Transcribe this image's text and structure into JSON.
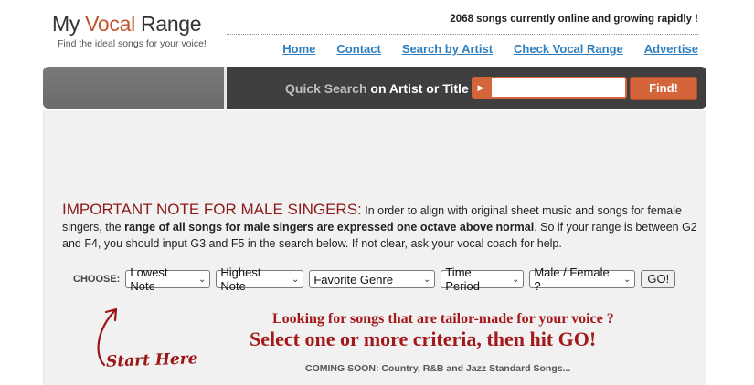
{
  "header": {
    "logo_part1": "My ",
    "logo_part2": "Vocal",
    "logo_part3": " Range",
    "tagline": "Find the ideal songs for your voice!",
    "songs_count": "2068 songs currently online and growing rapidly !",
    "nav": [
      "Home",
      "Contact",
      "Search by Artist",
      "Check Vocal Range",
      "Advertise"
    ]
  },
  "search": {
    "label_bold": "Quick Search",
    "label_rest": " on Artist or Title",
    "input_value": "",
    "button_label": "Find!",
    "arrow_glyph": "▶"
  },
  "note": {
    "heading": "IMPORTANT NOTE FOR MALE SINGERS:",
    "text1": " In order to align with original sheet music and songs for female singers, the ",
    "bold": "range of all songs for male singers are expressed one octave above normal",
    "text2": ". So if your range is between G2 and F4, you should input G3 and F5 in the search below. If not clear, ask your vocal coach for help."
  },
  "filters": {
    "label": "CHOOSE:",
    "selects": [
      "Lowest Note",
      "Highest Note",
      "Favorite Genre",
      "Time Period",
      "Male / Female ?"
    ],
    "go_label": "GO!"
  },
  "promo": {
    "start_here": "Start Here",
    "line1": "Looking for songs that are tailor-made for your voice ?",
    "line2": "Select one or more criteria, then hit GO!",
    "coming_soon": "COMING SOON: Country, R&B and Jazz Standard Songs..."
  },
  "colors": {
    "accent": "#d4643a",
    "link": "#2f7fbf",
    "heading_red": "#8b1a1a"
  }
}
